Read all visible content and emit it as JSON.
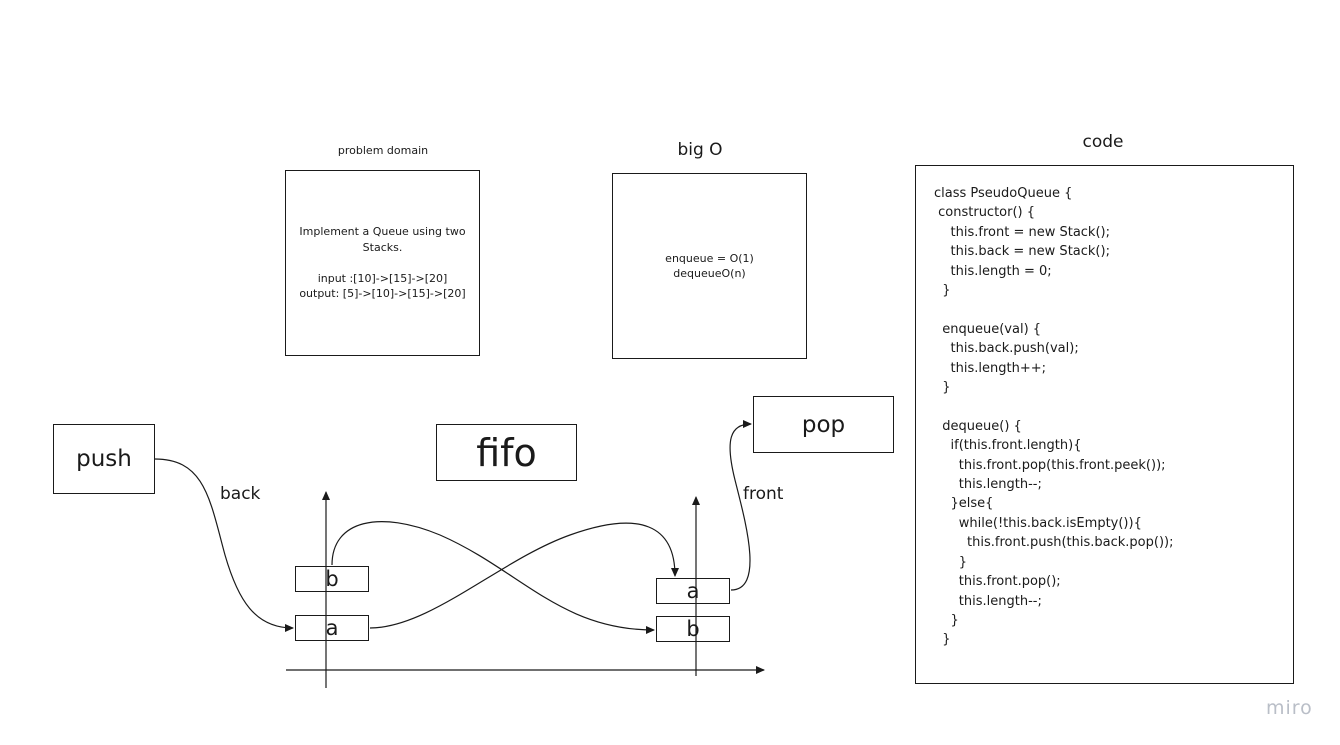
{
  "problem_domain": {
    "heading": "problem domain",
    "lines": [
      "Implement a Queue using two",
      "Stacks.",
      "",
      "input :[10]->[15]->[20]",
      "output: [5]->[10]->[15]->[20]"
    ]
  },
  "big_o": {
    "heading": "big O",
    "lines": [
      "enqueue = O(1)",
      "dequeueO(n)"
    ]
  },
  "code": {
    "heading": "code",
    "lines": [
      "class PseudoQueue {",
      " constructor() {",
      "    this.front = new Stack();",
      "    this.back = new Stack();",
      "    this.length = 0;",
      "  }",
      "",
      "  enqueue(val) {",
      "    this.back.push(val);",
      "    this.length++;",
      "  }",
      "",
      "  dequeue() {",
      "    if(this.front.length){",
      "      this.front.pop(this.front.peek());",
      "      this.length--;",
      "    }else{",
      "      while(!this.back.isEmpty()){",
      "        this.front.push(this.back.pop());",
      "      }",
      "      this.front.pop();",
      "      this.length--;",
      "    }",
      "  }"
    ]
  },
  "diagram": {
    "push_label": "push",
    "pop_label": "pop",
    "fifo_label": "fifo",
    "back_label": "back",
    "front_label": "front",
    "back_stack": [
      "b",
      "a"
    ],
    "front_stack": [
      "a",
      "b"
    ]
  },
  "watermark": "miro"
}
